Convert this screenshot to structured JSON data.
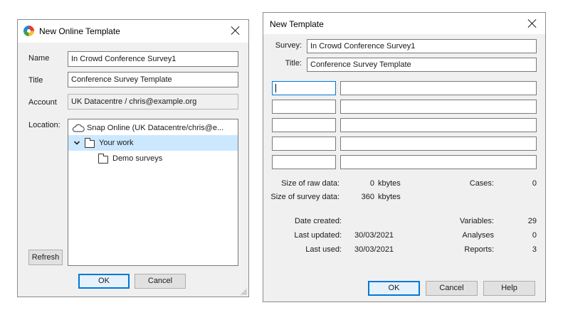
{
  "online_dialog": {
    "title": "New Online Template",
    "name_label": "Name",
    "name_value": "In Crowd Conference Survey1",
    "title_label": "Title",
    "title_value": "Conference Survey Template",
    "account_label": "Account",
    "account_value": "UK Datacentre / chris@example.org",
    "location_label": "Location:",
    "tree": [
      {
        "label": "Snap Online (UK Datacentre/chris@e...",
        "icon": "cloud-icon"
      },
      {
        "label": "Your work",
        "icon": "folder-icon",
        "expanded": true,
        "selected": true
      },
      {
        "label": "Demo surveys",
        "icon": "folder-icon"
      }
    ],
    "refresh_label": "Refresh",
    "ok_label": "OK",
    "cancel_label": "Cancel"
  },
  "template_dialog": {
    "title": "New Template",
    "survey_label": "Survey:",
    "survey_value": "In Crowd Conference Survey1",
    "title_label": "Title:",
    "title_value": "Conference Survey Template",
    "stats": {
      "raw_data_label": "Size of raw data:",
      "raw_data_value": "0",
      "raw_data_unit": "kbytes",
      "survey_data_label": "Size of survey data:",
      "survey_data_value": "360",
      "survey_data_unit": "kbytes",
      "cases_label": "Cases:",
      "cases_value": "0",
      "date_created_label": "Date created:",
      "date_created_value": "",
      "last_updated_label": "Last updated:",
      "last_updated_value": "30/03/2021",
      "last_used_label": "Last used:",
      "last_used_value": "30/03/2021",
      "variables_label": "Variables:",
      "variables_value": "29",
      "analyses_label": "Analyses",
      "analyses_value": "0",
      "reports_label": "Reports:",
      "reports_value": "3"
    },
    "ok_label": "OK",
    "cancel_label": "Cancel",
    "help_label": "Help"
  }
}
